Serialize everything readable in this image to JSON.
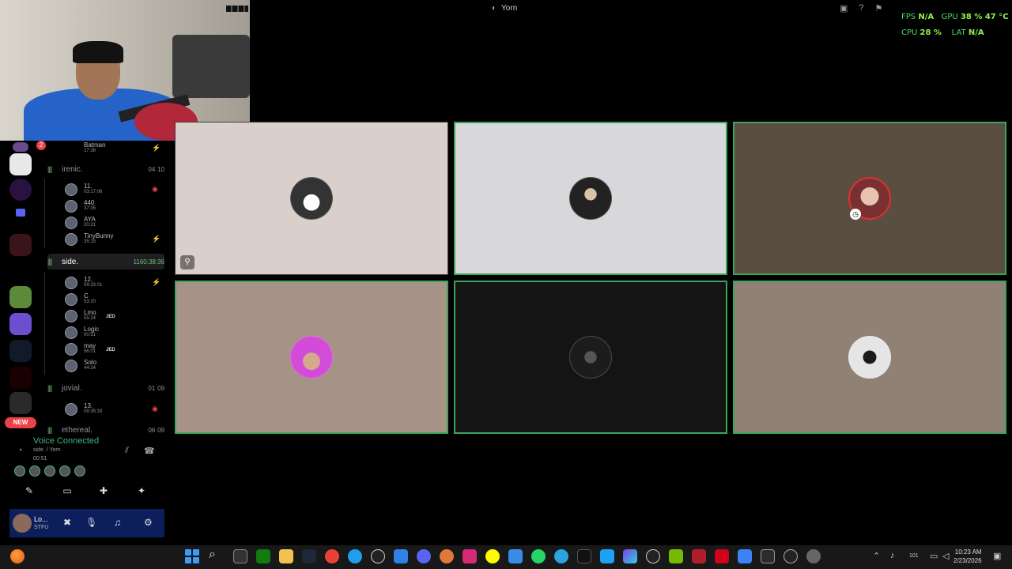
{
  "window": {
    "title": "Yorn"
  },
  "perf": {
    "fps_label": "FPS",
    "fps_value": "N/A",
    "gpu_label": "GPU",
    "gpu_value": "38 %  47 °C",
    "cpu_label": "CPU",
    "cpu_value": "28 %",
    "lat_label": "LAT",
    "lat_value": "N/A"
  },
  "rail": {
    "badge": "2",
    "new_label": "NEW"
  },
  "channels": {
    "top_user": {
      "name": "Batman",
      "time": "17:38"
    },
    "irenic": {
      "name": "irenic.",
      "count_a": "04",
      "count_b": "10",
      "users": [
        {
          "name": "11.",
          "time": "03:17:06"
        },
        {
          "name": "440",
          "time": "37:35"
        },
        {
          "name": "AYA",
          "time": "20:31"
        },
        {
          "name": "TinyBunny",
          "time": "35:15"
        }
      ]
    },
    "side": {
      "name": "side.",
      "count": "1160:38:36",
      "users": [
        {
          "name": "12.",
          "time": "09:33:01",
          "tag": ""
        },
        {
          "name": "C",
          "time": "53:20",
          "tag": ""
        },
        {
          "name": "Lmo",
          "time": "55:24",
          "tag": "JED"
        },
        {
          "name": "Logic",
          "time": "00:51",
          "tag": ""
        },
        {
          "name": "may",
          "time": "56:01",
          "tag": "JED"
        },
        {
          "name": "Solo",
          "time": "44:24",
          "tag": ""
        }
      ]
    },
    "jovial": {
      "name": "jovial.",
      "count_a": "01",
      "count_b": "09",
      "users": [
        {
          "name": "13.",
          "time": "09:35:33"
        }
      ]
    },
    "ethereal": {
      "name": "ethereal.",
      "count_a": "06",
      "count_b": "09"
    }
  },
  "voice": {
    "status": "Voice Connected",
    "location": "side. / Yorn",
    "elapsed": "00:51"
  },
  "user_panel": {
    "name": "Lo...",
    "status": "STFU"
  },
  "colors": {
    "speaking": "#3ba55c",
    "connected": "#43b581",
    "danger": "#ed4245"
  },
  "grid": {
    "tiles": [
      {
        "id": "tile-1",
        "bg": "#d9d0cb",
        "speaking": false,
        "avatar": "music-note-avatar"
      },
      {
        "id": "tile-2",
        "bg": "#d8d8db",
        "speaking": true,
        "avatar": "hooded-figure-avatar"
      },
      {
        "id": "tile-3",
        "bg": "#5a4e40",
        "speaking": true,
        "avatar": "smoking-girl-avatar"
      },
      {
        "id": "tile-4",
        "bg": "#a69287",
        "speaking": true,
        "avatar": "pink-hair-avatar"
      },
      {
        "id": "tile-5",
        "bg": "#141414",
        "speaking": true,
        "avatar": "dark-logo-avatar"
      },
      {
        "id": "tile-6",
        "bg": "#8f8174",
        "speaking": true,
        "avatar": "helmet-avatar"
      }
    ]
  },
  "taskbar": {
    "time": "10:23 AM",
    "date": "2/23/2026",
    "tray_count": "101"
  }
}
